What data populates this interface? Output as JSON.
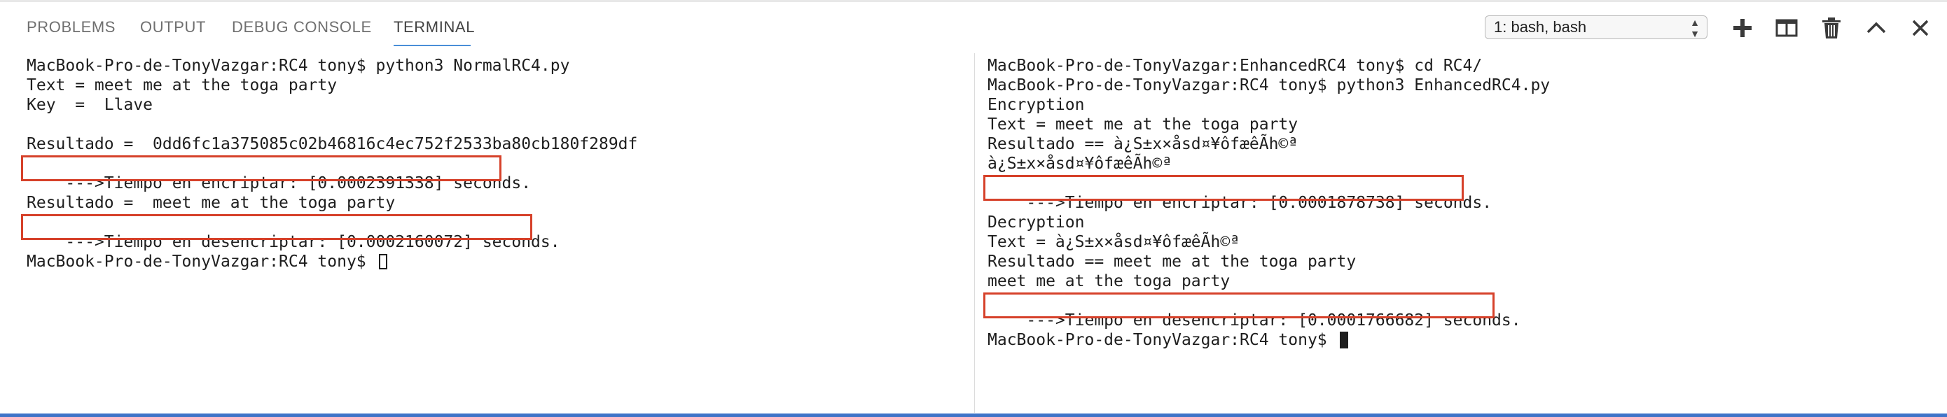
{
  "panel": {
    "tabs": [
      {
        "label": "PROBLEMS"
      },
      {
        "label": "OUTPUT"
      },
      {
        "label": "DEBUG CONSOLE"
      },
      {
        "label": "TERMINAL"
      }
    ],
    "active_tab": "TERMINAL",
    "terminal_select": "1: bash, bash",
    "icons": [
      "plus-icon",
      "split-terminal-icon",
      "trash-icon",
      "chevron-up-icon",
      "close-icon"
    ]
  },
  "colors": {
    "highlight_box": "#d6412a",
    "active_tab_underline": "#4a8ed8",
    "status_bar": "#3f74c8"
  },
  "left_terminal": {
    "lines": [
      "MacBook-Pro-de-TonyVazgar:RC4 tony$ python3 NormalRC4.py",
      "Text = meet me at the toga party",
      "Key  =  Llave",
      "",
      "Resultado =  0dd6fc1a375085c02b46816c4ec752f2533ba80cb180f289df",
      "--->Tiempo en encriptar: [0.0002391338] seconds.",
      "",
      "Resultado =  meet me at the toga party",
      "--->Tiempo en desencriptar: [0.0002160072] seconds.",
      "",
      "MacBook-Pro-de-TonyVazgar:RC4 tony$ "
    ]
  },
  "right_terminal": {
    "lines": [
      "MacBook-Pro-de-TonyVazgar:EnhancedRC4 tony$ cd RC4/",
      "MacBook-Pro-de-TonyVazgar:RC4 tony$ python3 EnhancedRC4.py",
      "Encryption",
      "Text = meet me at the toga party",
      "Resultado == à¿S±x×åsd¤¥ôfæêÃh©ª",
      "à¿S±x×åsd¤¥ôfæêÃh©ª",
      "--->Tiempo en encriptar: [0.0001878738] seconds.",
      "",
      "Decryption",
      "Text = à¿S±x×åsd¤¥ôfæêÃh©ª",
      "Resultado == meet me at the toga party",
      "meet me at the toga party",
      "--->Tiempo en desencriptar: [0.0001766682] seconds.",
      "",
      "MacBook-Pro-de-TonyVazgar:RC4 tony$ "
    ]
  }
}
